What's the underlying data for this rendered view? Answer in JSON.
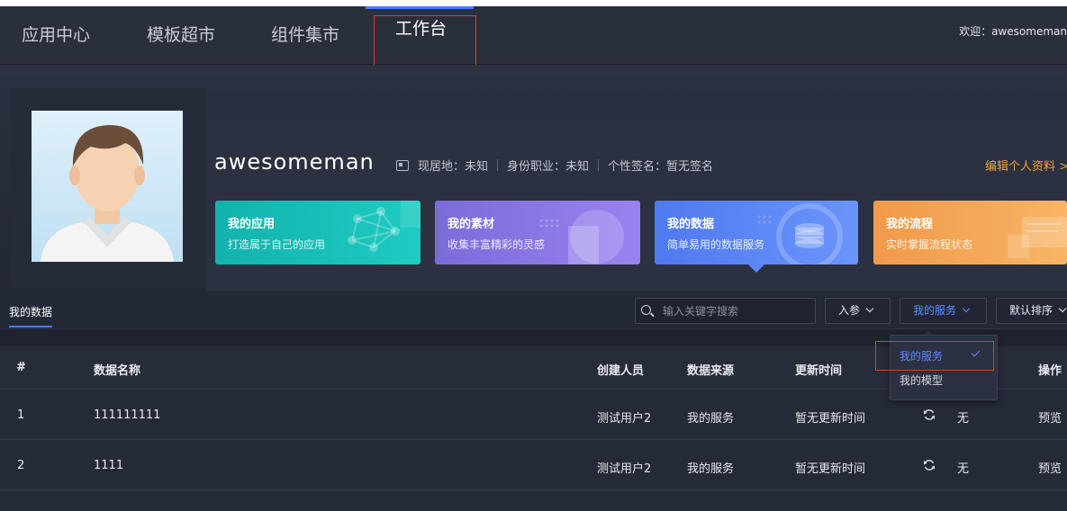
{
  "topnav": {
    "items": [
      {
        "label": "应用中心"
      },
      {
        "label": "模板超市"
      },
      {
        "label": "组件集市"
      },
      {
        "label": "工作台",
        "active": true
      }
    ],
    "welcome": "欢迎：awesomeman"
  },
  "profile": {
    "username": "awesomeman",
    "location": "现居地：未知",
    "job": "身份职业：未知",
    "signature": "个性签名：暂无签名",
    "edit_link": "编辑个人资料 >"
  },
  "quick_cards": [
    {
      "title": "我的应用",
      "subtitle": "打造属于自己的应用",
      "color": "#14b8b0"
    },
    {
      "title": "我的素材",
      "subtitle": "收集丰富精彩的灵感",
      "color": "#8473e3"
    },
    {
      "title": "我的数据",
      "subtitle": "简单易用的数据服务",
      "color": "#5a84f5",
      "active": true
    },
    {
      "title": "我的流程",
      "subtitle": "实时掌握流程状态",
      "color": "#f3a655"
    }
  ],
  "toolbar": {
    "tab": "我的数据",
    "search_placeholder": "输入关键字搜索",
    "param_label": "入参",
    "service_label": "我的服务",
    "sort_label": "默认排序"
  },
  "service_menu": {
    "options": [
      "我的服务",
      "我的模型"
    ],
    "selected": "我的服务"
  },
  "table": {
    "headers": {
      "index": "#",
      "name": "数据名称",
      "creator": "创建人员",
      "source": "数据来源",
      "updated": "更新时间",
      "actions": "操作"
    },
    "rows": [
      {
        "index": "1",
        "name": "111111111",
        "creator": "测试用户2",
        "source": "我的服务",
        "updated": "暂无更新时间",
        "status": "无",
        "action": "预览"
      },
      {
        "index": "2",
        "name": "1111",
        "creator": "测试用户2",
        "source": "我的服务",
        "updated": "暂无更新时间",
        "status": "无",
        "action": "预览"
      }
    ]
  },
  "colors": {
    "accent": "#4a7cf7",
    "highlight": "#ee3333",
    "edit_link": "#f2a23a"
  }
}
